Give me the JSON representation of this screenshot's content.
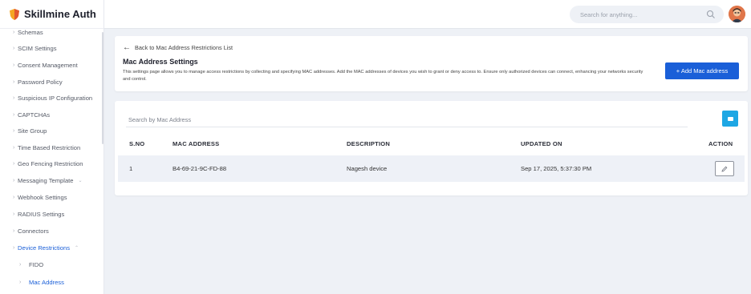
{
  "brand": {
    "name": "Skillmine Auth"
  },
  "sidebar": {
    "items": [
      {
        "label": "Schemas"
      },
      {
        "label": "SCIM Settings"
      },
      {
        "label": "Consent Management"
      },
      {
        "label": "Password Policy"
      },
      {
        "label": "Suspicious IP Configuration"
      },
      {
        "label": "CAPTCHAs"
      },
      {
        "label": "Site Group"
      },
      {
        "label": "Time Based Restriction"
      },
      {
        "label": "Geo Fencing Restriction"
      },
      {
        "label": "Messaging Template"
      },
      {
        "label": "Webhook Settings"
      },
      {
        "label": "RADIUS Settings"
      },
      {
        "label": "Connectors"
      },
      {
        "label": "Device Restrictions"
      },
      {
        "label": "FIDO"
      },
      {
        "label": "Mac Address"
      }
    ]
  },
  "topbar": {
    "search_placeholder": "Search for anything..."
  },
  "header": {
    "back_label": "Back to Mac Address Restrictions List",
    "title": "Mac Address Settings",
    "description": "This settings page allows you to manage access restrictions by collecting and specifying MAC addresses. Add the MAC addresses of devices you wish to grant or deny access to. Ensure only authorized devices can connect, enhancing your networks security and control.",
    "add_button_label": "+ Add Mac address"
  },
  "table": {
    "search_placeholder": "Search by Mac Address",
    "columns": [
      "S.NO",
      "MAC ADDRESS",
      "DESCRIPTION",
      "UPDATED ON",
      "ACTION"
    ],
    "rows": [
      {
        "sno": "1",
        "mac": "B4-69-21-9C-FD-88",
        "description": "Nagesh device",
        "updated": "Sep 17, 2025, 5:37:30 PM"
      }
    ]
  },
  "colors": {
    "accent": "#1a5fd8",
    "filter": "#1ea7e4",
    "row_bg": "#eef1f7"
  }
}
